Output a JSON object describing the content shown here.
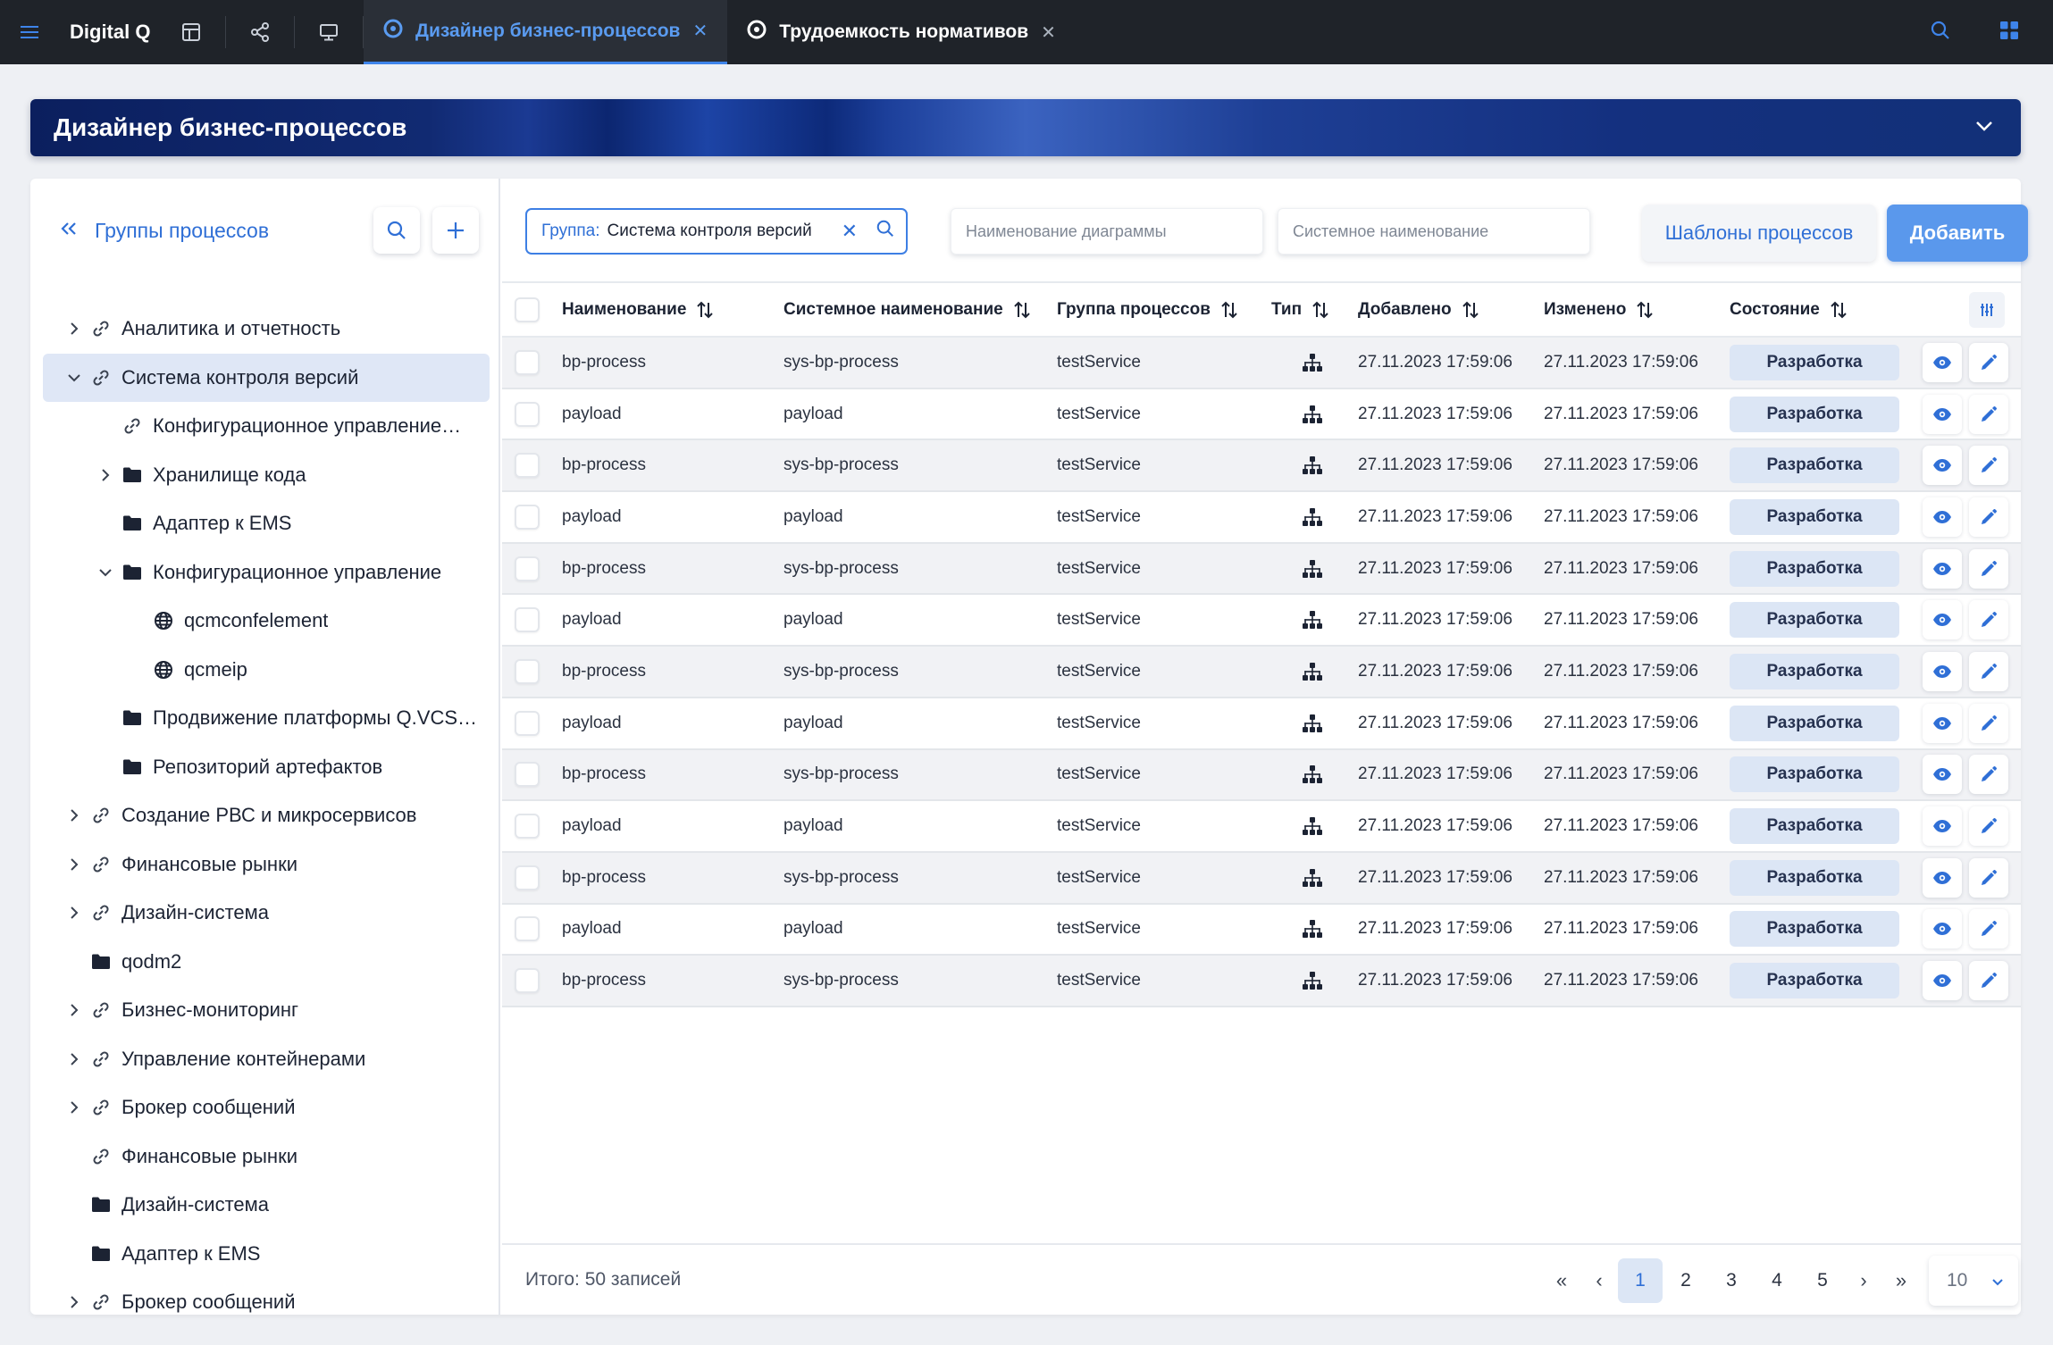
{
  "app": {
    "name": "Digital Q"
  },
  "tabs": [
    {
      "label": "Дизайнер бизнес-процессов",
      "active": true
    },
    {
      "label": "Трудоемкость нормативов",
      "active": false
    }
  ],
  "banner": {
    "title": "Дизайнер бизнес-процессов"
  },
  "sidebar": {
    "title": "Группы процессов",
    "items": [
      {
        "label": "Аналитика и отчетность",
        "icon": "link-icon",
        "level": 0,
        "chevron": "right"
      },
      {
        "label": "Система контроля версий",
        "icon": "link-icon",
        "level": 0,
        "chevron": "down",
        "selected": true
      },
      {
        "label": "Конфигурационное управление…",
        "icon": "link-icon",
        "level": 1,
        "chevron": ""
      },
      {
        "label": "Хранилище кода",
        "icon": "folder-icon",
        "level": 1,
        "chevron": "right"
      },
      {
        "label": "Адаптер к EMS",
        "icon": "folder-icon",
        "level": 1,
        "chevron": ""
      },
      {
        "label": "Конфигурационное управление",
        "icon": "folder-icon",
        "level": 1,
        "chevron": "down"
      },
      {
        "label": "qcmconfelement",
        "icon": "globe-icon",
        "level": 2,
        "chevron": ""
      },
      {
        "label": "qcmeip",
        "icon": "globe-icon",
        "level": 2,
        "chevron": ""
      },
      {
        "label": "Продвижение платформы Q.VCS…",
        "icon": "folder-icon",
        "level": 1,
        "chevron": ""
      },
      {
        "label": "Репозиторий артефактов",
        "icon": "folder-icon",
        "level": 1,
        "chevron": ""
      },
      {
        "label": "Создание РВС и микросервисов",
        "icon": "link-icon",
        "level": 0,
        "chevron": "right"
      },
      {
        "label": "Финансовые рынки",
        "icon": "link-icon",
        "level": 0,
        "chevron": "right"
      },
      {
        "label": "Дизайн-система",
        "icon": "link-icon",
        "level": 0,
        "chevron": "right"
      },
      {
        "label": "qodm2",
        "icon": "folder-icon",
        "level": 0,
        "chevron": ""
      },
      {
        "label": "Бизнес-мониторинг",
        "icon": "link-icon",
        "level": 0,
        "chevron": "right"
      },
      {
        "label": "Управление контейнерами",
        "icon": "link-icon",
        "level": 0,
        "chevron": "right"
      },
      {
        "label": "Брокер сообщений",
        "icon": "link-icon",
        "level": 0,
        "chevron": "right"
      },
      {
        "label": "Финансовые рынки",
        "icon": "link-icon",
        "level": 0,
        "chevron": ""
      },
      {
        "label": "Дизайн-система",
        "icon": "folder-icon",
        "level": 0,
        "chevron": ""
      },
      {
        "label": "Адаптер к EMS",
        "icon": "folder-icon",
        "level": 0,
        "chevron": ""
      },
      {
        "label": "Брокер сообщений",
        "icon": "link-icon",
        "level": 0,
        "chevron": "right"
      }
    ]
  },
  "filters": {
    "group_label": "Группа:",
    "group_value": "Система контроля версий",
    "diagram_placeholder": "Наименование диаграммы",
    "system_placeholder": "Системное наименование"
  },
  "actions": {
    "templates": "Шаблоны процессов",
    "add": "Добавить"
  },
  "table": {
    "columns": [
      "Наименование",
      "Системное наименование",
      "Группа процессов",
      "Тип",
      "Добавлено",
      "Изменено",
      "Состояние"
    ],
    "rows": [
      {
        "name": "bp-process",
        "system": "sys-bp-process",
        "group": "testService",
        "added": "27.11.2023 17:59:06",
        "changed": "27.11.2023 17:59:06",
        "status": "Разработка"
      },
      {
        "name": "payload",
        "system": "payload",
        "group": "testService",
        "added": "27.11.2023 17:59:06",
        "changed": "27.11.2023 17:59:06",
        "status": "Разработка"
      },
      {
        "name": "bp-process",
        "system": "sys-bp-process",
        "group": "testService",
        "added": "27.11.2023 17:59:06",
        "changed": "27.11.2023 17:59:06",
        "status": "Разработка"
      },
      {
        "name": "payload",
        "system": "payload",
        "group": "testService",
        "added": "27.11.2023 17:59:06",
        "changed": "27.11.2023 17:59:06",
        "status": "Разработка"
      },
      {
        "name": "bp-process",
        "system": "sys-bp-process",
        "group": "testService",
        "added": "27.11.2023 17:59:06",
        "changed": "27.11.2023 17:59:06",
        "status": "Разработка"
      },
      {
        "name": "payload",
        "system": "payload",
        "group": "testService",
        "added": "27.11.2023 17:59:06",
        "changed": "27.11.2023 17:59:06",
        "status": "Разработка"
      },
      {
        "name": "bp-process",
        "system": "sys-bp-process",
        "group": "testService",
        "added": "27.11.2023 17:59:06",
        "changed": "27.11.2023 17:59:06",
        "status": "Разработка"
      },
      {
        "name": "payload",
        "system": "payload",
        "group": "testService",
        "added": "27.11.2023 17:59:06",
        "changed": "27.11.2023 17:59:06",
        "status": "Разработка"
      },
      {
        "name": "bp-process",
        "system": "sys-bp-process",
        "group": "testService",
        "added": "27.11.2023 17:59:06",
        "changed": "27.11.2023 17:59:06",
        "status": "Разработка"
      },
      {
        "name": "payload",
        "system": "payload",
        "group": "testService",
        "added": "27.11.2023 17:59:06",
        "changed": "27.11.2023 17:59:06",
        "status": "Разработка"
      },
      {
        "name": "bp-process",
        "system": "sys-bp-process",
        "group": "testService",
        "added": "27.11.2023 17:59:06",
        "changed": "27.11.2023 17:59:06",
        "status": "Разработка"
      },
      {
        "name": "payload",
        "system": "payload",
        "group": "testService",
        "added": "27.11.2023 17:59:06",
        "changed": "27.11.2023 17:59:06",
        "status": "Разработка"
      },
      {
        "name": "bp-process",
        "system": "sys-bp-process",
        "group": "testService",
        "added": "27.11.2023 17:59:06",
        "changed": "27.11.2023 17:59:06",
        "status": "Разработка"
      }
    ]
  },
  "footer": {
    "total": "Итого: 50 записей",
    "first": "«",
    "prev": "‹",
    "next": "›",
    "last": "»",
    "pages": [
      "1",
      "2",
      "3",
      "4",
      "5"
    ],
    "current_page": "1",
    "page_size": "10"
  },
  "colors": {
    "accent": "#2f6fd6",
    "topbar": "#1f2329",
    "status_bg": "#dce6f5"
  }
}
